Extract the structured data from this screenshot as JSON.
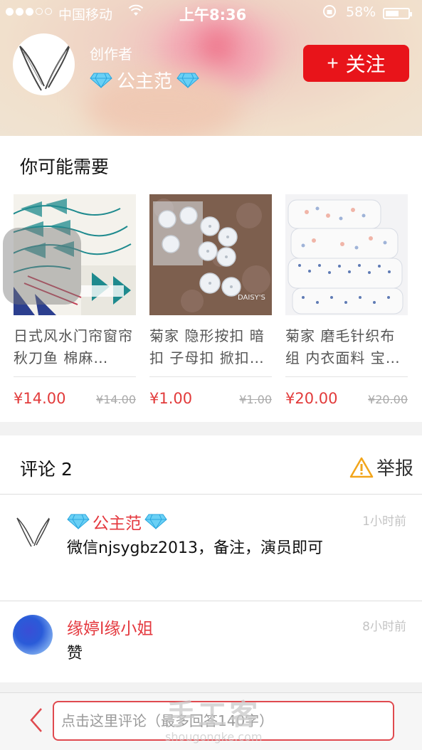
{
  "status_bar": {
    "carrier": "中国移动",
    "time": "上午8:36",
    "battery_percent": "58%",
    "signal_filled": 3,
    "signal_total": 5
  },
  "header": {
    "creator_label": "创作者",
    "creator_name": "公主范",
    "follow_icon": "+",
    "follow_label": "关注"
  },
  "recommendations": {
    "title": "你可能需要",
    "items": [
      {
        "name": "日式风水门帘窗帘 秋刀鱼 棉麻…",
        "price": "¥14.00",
        "original_price": "¥14.00"
      },
      {
        "name": "菊家 隐形按扣 暗扣 子母扣 掀扣…",
        "price": "¥1.00",
        "original_price": "¥1.00",
        "image_brand": "DAISY'S"
      },
      {
        "name": "菊家 磨毛针织布组 内衣面料 宝…",
        "price": "¥20.00",
        "original_price": "¥20.00"
      }
    ]
  },
  "comments": {
    "title": "评论 2",
    "report_label": "举报",
    "items": [
      {
        "user": "公主范",
        "time": "1小时前",
        "text": "微信njsygbz2013，备注，演员即可"
      },
      {
        "user": "缘婷l缘小姐",
        "time": "8小时前",
        "text": "赞"
      }
    ]
  },
  "bottom_bar": {
    "placeholder": "点击这里评论（最多回答140字）"
  },
  "watermark": {
    "main": "手工客",
    "sub": "shougongke.com"
  },
  "colors": {
    "accent": "#e8141a",
    "name_red": "#e4383e",
    "price_red": "#e23b3b"
  },
  "icons": [
    "rabbit-ears-avatar",
    "diamond-icon",
    "warning-icon",
    "back-chevron-icon"
  ]
}
